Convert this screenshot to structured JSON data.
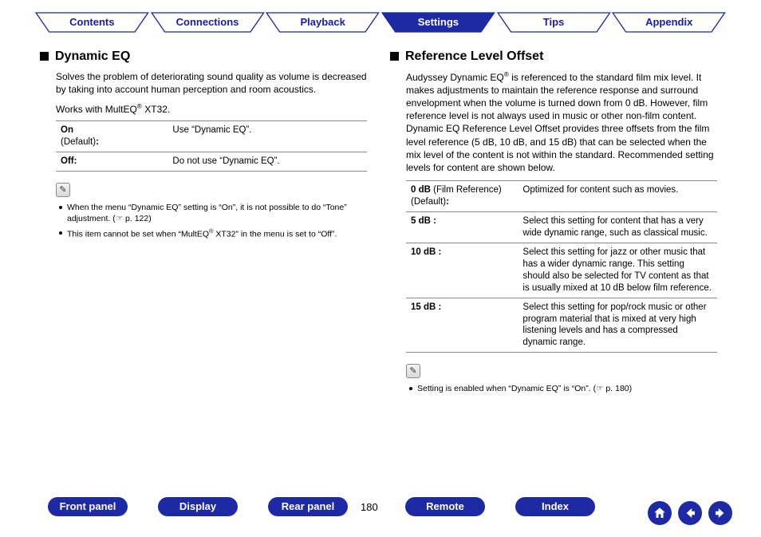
{
  "tabs": {
    "contents": "Contents",
    "connections": "Connections",
    "playback": "Playback",
    "settings": "Settings",
    "tips": "Tips",
    "appendix": "Appendix",
    "active": "settings"
  },
  "left": {
    "heading": "Dynamic EQ",
    "desc": "Solves the problem of deteriorating sound quality as volume is decreased by taking into account human perception and room acoustics.",
    "works_pre": "Works with MultEQ",
    "works_post": " XT32.",
    "row1_key": "On",
    "row1_sub": "(Default)",
    "row1_colon": ":",
    "row1_val": "Use “Dynamic EQ”.",
    "row2_key": "Off:",
    "row2_val": "Do not use “Dynamic EQ”.",
    "note1_a": "When the menu “Dynamic EQ” setting is “On”, it is not possible to do “Tone” adjustment.  (",
    "note1_b": " p. 122)",
    "note2_a": "This item cannot be set when “MultEQ",
    "note2_b": " XT32” in the menu is set to “Off”."
  },
  "right": {
    "heading": "Reference Level Offset",
    "desc_a": "Audyssey Dynamic EQ",
    "desc_b": " is referenced to the standard film mix level. It makes adjustments to maintain the reference response and surround envelopment when the volume is turned down from 0 dB. However, film reference level is not always used in music or other non-film content. Dynamic EQ Reference Level Offset provides three offsets from the film level reference (5 dB, 10 dB, and 15 dB) that can be selected when the mix level of the content is not within the standard. Recommended setting levels for content are shown below.",
    "r1_key_a": "0 dB",
    "r1_key_b": " (Film Reference)",
    "r1_sub": "(Default)",
    "r1_colon": ":",
    "r1_val": "Optimized for content such as movies.",
    "r2_key": "5 dB :",
    "r2_val": "Select this setting for content that has a very wide dynamic range, such as classical music.",
    "r3_key": "10 dB :",
    "r3_val": "Select this setting for jazz or other music that has a wider dynamic range. This setting should also be selected for TV content as that is usually mixed at 10 dB below film reference.",
    "r4_key": "15 dB :",
    "r4_val": "Select this setting for pop/rock music or other program material that is mixed at very high listening levels and has a compressed dynamic range.",
    "noteR_a": "Setting is enabled when “Dynamic EQ” is “On”.  (",
    "noteR_b": " p. 180)"
  },
  "bottom": {
    "frontpanel": "Front panel",
    "display": "Display",
    "rearpanel": "Rear panel",
    "page": "180",
    "remote": "Remote",
    "index": "Index"
  },
  "glyphs": {
    "reg": "®",
    "hand": "☞",
    "pencil": "✎"
  }
}
